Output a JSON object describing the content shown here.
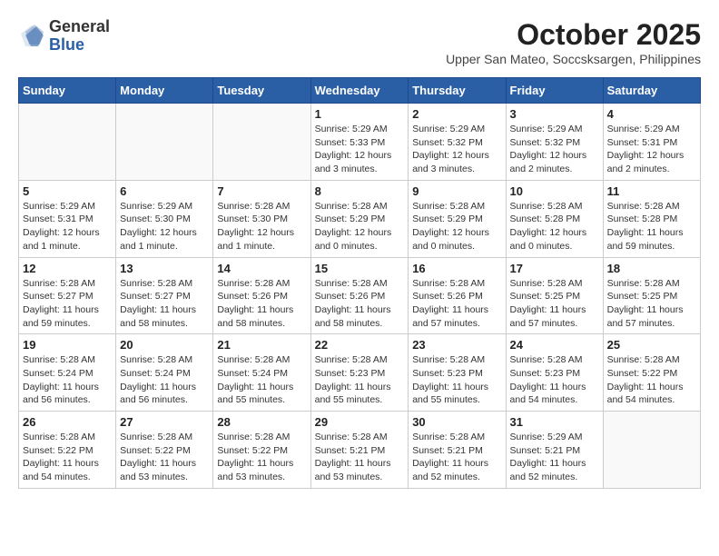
{
  "logo": {
    "general": "General",
    "blue": "Blue"
  },
  "title": "October 2025",
  "subtitle": "Upper San Mateo, Soccsksargen, Philippines",
  "weekdays": [
    "Sunday",
    "Monday",
    "Tuesday",
    "Wednesday",
    "Thursday",
    "Friday",
    "Saturday"
  ],
  "weeks": [
    [
      {
        "day": "",
        "info": ""
      },
      {
        "day": "",
        "info": ""
      },
      {
        "day": "",
        "info": ""
      },
      {
        "day": "1",
        "info": "Sunrise: 5:29 AM\nSunset: 5:33 PM\nDaylight: 12 hours and 3 minutes."
      },
      {
        "day": "2",
        "info": "Sunrise: 5:29 AM\nSunset: 5:32 PM\nDaylight: 12 hours and 3 minutes."
      },
      {
        "day": "3",
        "info": "Sunrise: 5:29 AM\nSunset: 5:32 PM\nDaylight: 12 hours and 2 minutes."
      },
      {
        "day": "4",
        "info": "Sunrise: 5:29 AM\nSunset: 5:31 PM\nDaylight: 12 hours and 2 minutes."
      }
    ],
    [
      {
        "day": "5",
        "info": "Sunrise: 5:29 AM\nSunset: 5:31 PM\nDaylight: 12 hours and 1 minute."
      },
      {
        "day": "6",
        "info": "Sunrise: 5:29 AM\nSunset: 5:30 PM\nDaylight: 12 hours and 1 minute."
      },
      {
        "day": "7",
        "info": "Sunrise: 5:28 AM\nSunset: 5:30 PM\nDaylight: 12 hours and 1 minute."
      },
      {
        "day": "8",
        "info": "Sunrise: 5:28 AM\nSunset: 5:29 PM\nDaylight: 12 hours and 0 minutes."
      },
      {
        "day": "9",
        "info": "Sunrise: 5:28 AM\nSunset: 5:29 PM\nDaylight: 12 hours and 0 minutes."
      },
      {
        "day": "10",
        "info": "Sunrise: 5:28 AM\nSunset: 5:28 PM\nDaylight: 12 hours and 0 minutes."
      },
      {
        "day": "11",
        "info": "Sunrise: 5:28 AM\nSunset: 5:28 PM\nDaylight: 11 hours and 59 minutes."
      }
    ],
    [
      {
        "day": "12",
        "info": "Sunrise: 5:28 AM\nSunset: 5:27 PM\nDaylight: 11 hours and 59 minutes."
      },
      {
        "day": "13",
        "info": "Sunrise: 5:28 AM\nSunset: 5:27 PM\nDaylight: 11 hours and 58 minutes."
      },
      {
        "day": "14",
        "info": "Sunrise: 5:28 AM\nSunset: 5:26 PM\nDaylight: 11 hours and 58 minutes."
      },
      {
        "day": "15",
        "info": "Sunrise: 5:28 AM\nSunset: 5:26 PM\nDaylight: 11 hours and 58 minutes."
      },
      {
        "day": "16",
        "info": "Sunrise: 5:28 AM\nSunset: 5:26 PM\nDaylight: 11 hours and 57 minutes."
      },
      {
        "day": "17",
        "info": "Sunrise: 5:28 AM\nSunset: 5:25 PM\nDaylight: 11 hours and 57 minutes."
      },
      {
        "day": "18",
        "info": "Sunrise: 5:28 AM\nSunset: 5:25 PM\nDaylight: 11 hours and 57 minutes."
      }
    ],
    [
      {
        "day": "19",
        "info": "Sunrise: 5:28 AM\nSunset: 5:24 PM\nDaylight: 11 hours and 56 minutes."
      },
      {
        "day": "20",
        "info": "Sunrise: 5:28 AM\nSunset: 5:24 PM\nDaylight: 11 hours and 56 minutes."
      },
      {
        "day": "21",
        "info": "Sunrise: 5:28 AM\nSunset: 5:24 PM\nDaylight: 11 hours and 55 minutes."
      },
      {
        "day": "22",
        "info": "Sunrise: 5:28 AM\nSunset: 5:23 PM\nDaylight: 11 hours and 55 minutes."
      },
      {
        "day": "23",
        "info": "Sunrise: 5:28 AM\nSunset: 5:23 PM\nDaylight: 11 hours and 55 minutes."
      },
      {
        "day": "24",
        "info": "Sunrise: 5:28 AM\nSunset: 5:23 PM\nDaylight: 11 hours and 54 minutes."
      },
      {
        "day": "25",
        "info": "Sunrise: 5:28 AM\nSunset: 5:22 PM\nDaylight: 11 hours and 54 minutes."
      }
    ],
    [
      {
        "day": "26",
        "info": "Sunrise: 5:28 AM\nSunset: 5:22 PM\nDaylight: 11 hours and 54 minutes."
      },
      {
        "day": "27",
        "info": "Sunrise: 5:28 AM\nSunset: 5:22 PM\nDaylight: 11 hours and 53 minutes."
      },
      {
        "day": "28",
        "info": "Sunrise: 5:28 AM\nSunset: 5:22 PM\nDaylight: 11 hours and 53 minutes."
      },
      {
        "day": "29",
        "info": "Sunrise: 5:28 AM\nSunset: 5:21 PM\nDaylight: 11 hours and 53 minutes."
      },
      {
        "day": "30",
        "info": "Sunrise: 5:28 AM\nSunset: 5:21 PM\nDaylight: 11 hours and 52 minutes."
      },
      {
        "day": "31",
        "info": "Sunrise: 5:29 AM\nSunset: 5:21 PM\nDaylight: 11 hours and 52 minutes."
      },
      {
        "day": "",
        "info": ""
      }
    ]
  ]
}
